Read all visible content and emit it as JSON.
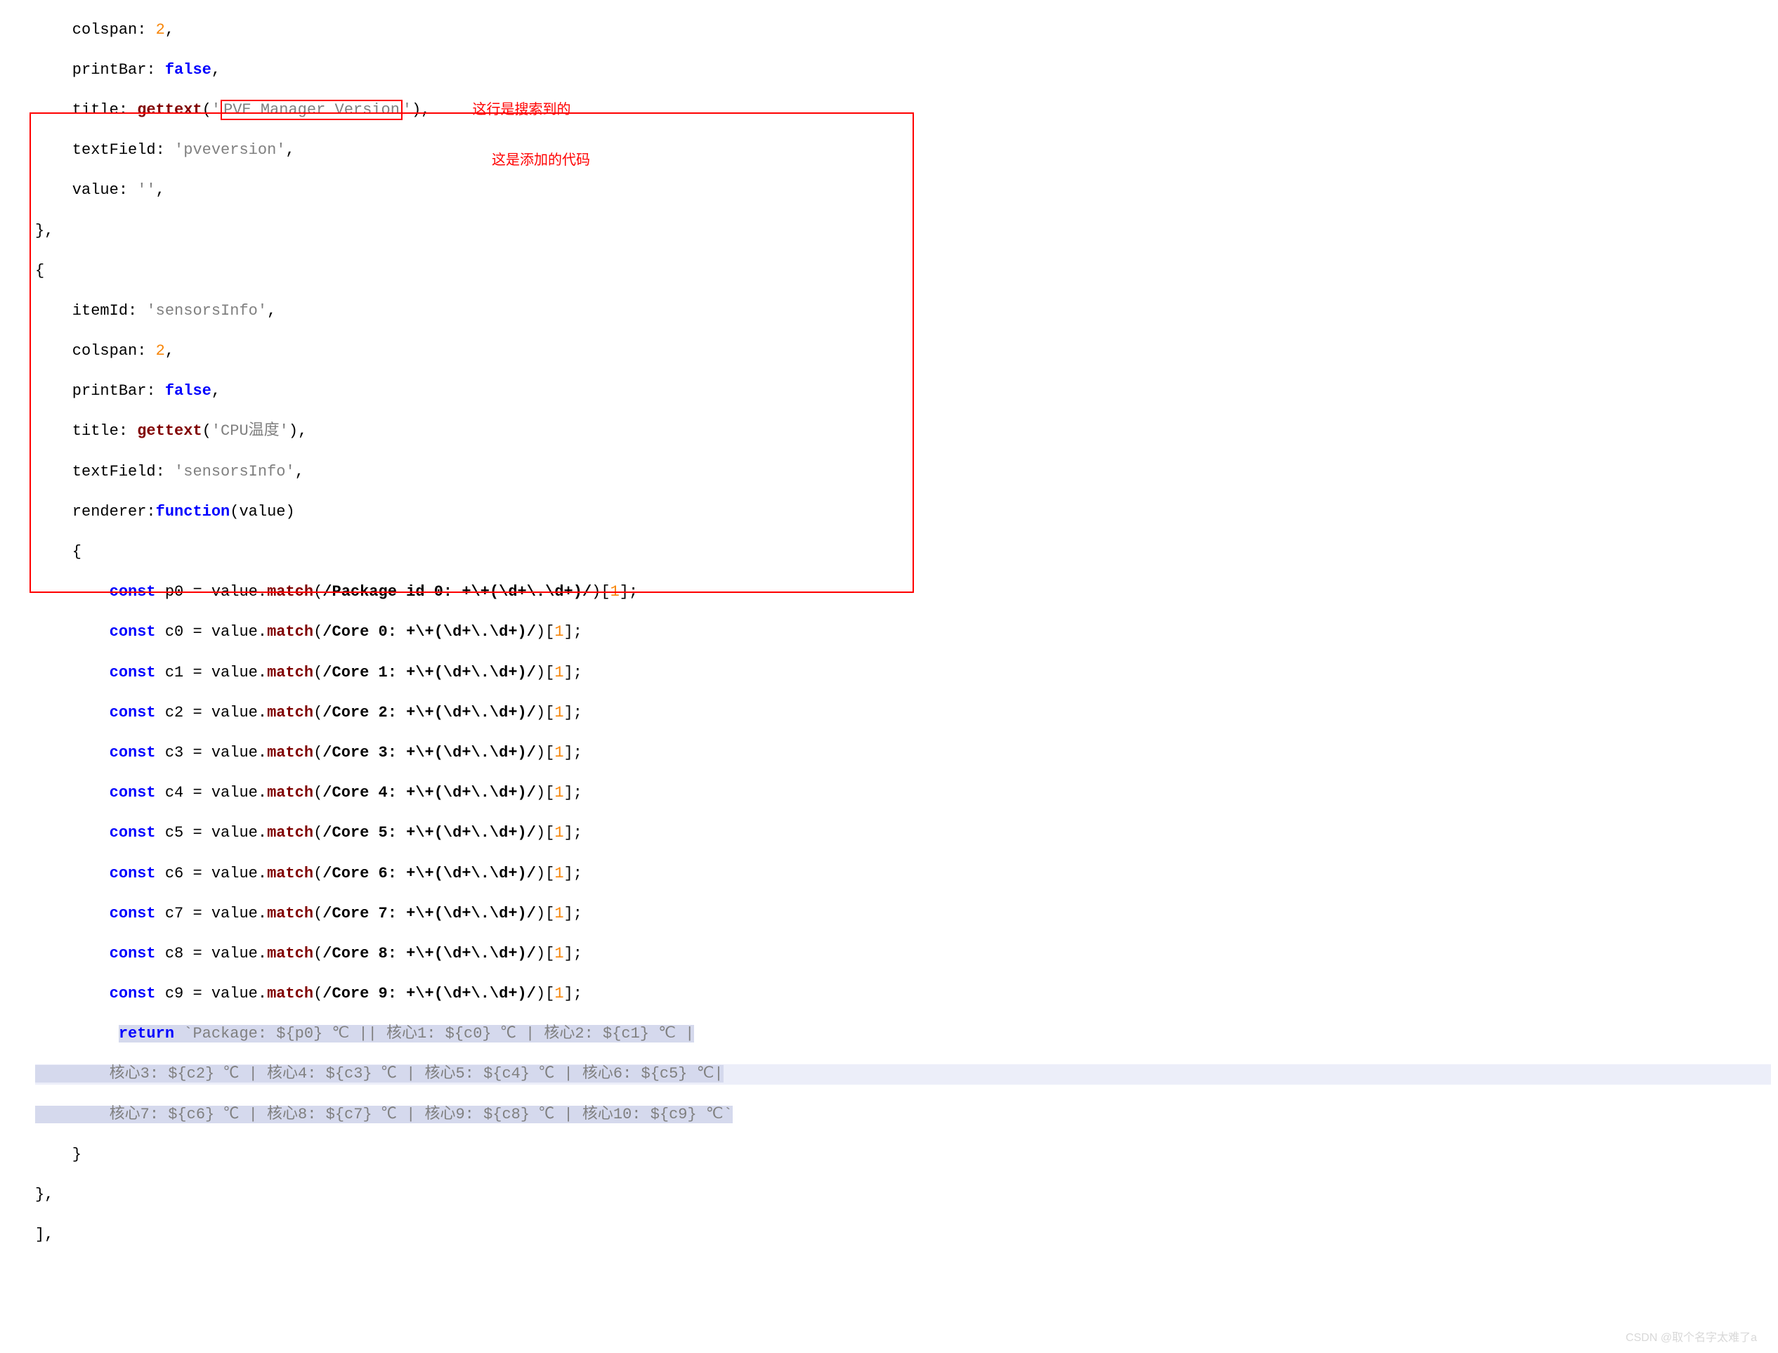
{
  "annotations": {
    "note1": "这行是搜索到的",
    "note2": "这是添加的代码"
  },
  "code_block1": {
    "l1": "    colspan: ",
    "l1n": "2",
    "l1e": ",",
    "l2": "    printBar: ",
    "l2k": "false",
    "l2e": ",",
    "l3a": "    title: ",
    "l3f": "gettext",
    "l3p1": "(",
    "l3s1": "'",
    "l3box": "PVE Manager Version",
    "l3s2": "'",
    "l3p2": "),",
    "l4": "    textField: ",
    "l4s": "'pveversion'",
    "l4e": ",",
    "l5": "    value: ",
    "l5s": "''",
    "l5e": ",",
    "l6": "},"
  },
  "code_block2": {
    "l7": "{",
    "l8": "    itemId: ",
    "l8s": "'sensorsInfo'",
    "l8e": ",",
    "l9": "    colspan: ",
    "l9n": "2",
    "l9e": ",",
    "l10": "    printBar: ",
    "l10k": "false",
    "l10e": ",",
    "l11a": "    title: ",
    "l11f": "gettext",
    "l11p1": "(",
    "l11s": "'CPU温度'",
    "l11p2": "),",
    "l12": "    textField: ",
    "l12s": "'sensorsInfo'",
    "l12e": ",",
    "l13a": "    renderer:",
    "l13f": "function",
    "l13p": "(value)",
    "l14": "    {",
    "c_kw": "const",
    "eq": " = value.",
    "mfn": "match",
    "p0v": " p0",
    "p0r": "/Package id 0: +\\+(\\d+\\.\\d+)/",
    "idx": "1",
    "c0v": " c0",
    "c0r": "/Core 0: +\\+(\\d+\\.\\d+)/",
    "c1v": " c1",
    "c1r": "/Core 1: +\\+(\\d+\\.\\d+)/",
    "c2v": " c2",
    "c2r": "/Core 2: +\\+(\\d+\\.\\d+)/",
    "c3v": " c3",
    "c3r": "/Core 3: +\\+(\\d+\\.\\d+)/",
    "c4v": " c4",
    "c4r": "/Core 4: +\\+(\\d+\\.\\d+)/",
    "c5v": " c5",
    "c5r": "/Core 5: +\\+(\\d+\\.\\d+)/",
    "c6v": " c6",
    "c6r": "/Core 6: +\\+(\\d+\\.\\d+)/",
    "c7v": " c7",
    "c7r": "/Core 7: +\\+(\\d+\\.\\d+)/",
    "c8v": " c8",
    "c8r": "/Core 8: +\\+(\\d+\\.\\d+)/",
    "c9v": " c9",
    "c9r": "/Core 9: +\\+(\\d+\\.\\d+)/",
    "ret_kw": "return",
    "ret1": " `Package: ${p0} ℃ || 核心1: ${c0} ℃ | 核心2: ${c1} ℃ |",
    "ret2": "        核心3: ${c2} ℃ | 核心4: ${c3} ℃ | 核心5: ${c4} ℃ | 核心6: ${c5} ℃|",
    "ret3": "        核心7: ${c6} ℃ | 核心8: ${c7} ℃ | 核心9: ${c8} ℃ | 核心10: ${c9} ℃`",
    "l_end1": "    }",
    "l_end2": "},",
    "l_end3": "],"
  },
  "watermark": "CSDN @取个名字太难了a"
}
